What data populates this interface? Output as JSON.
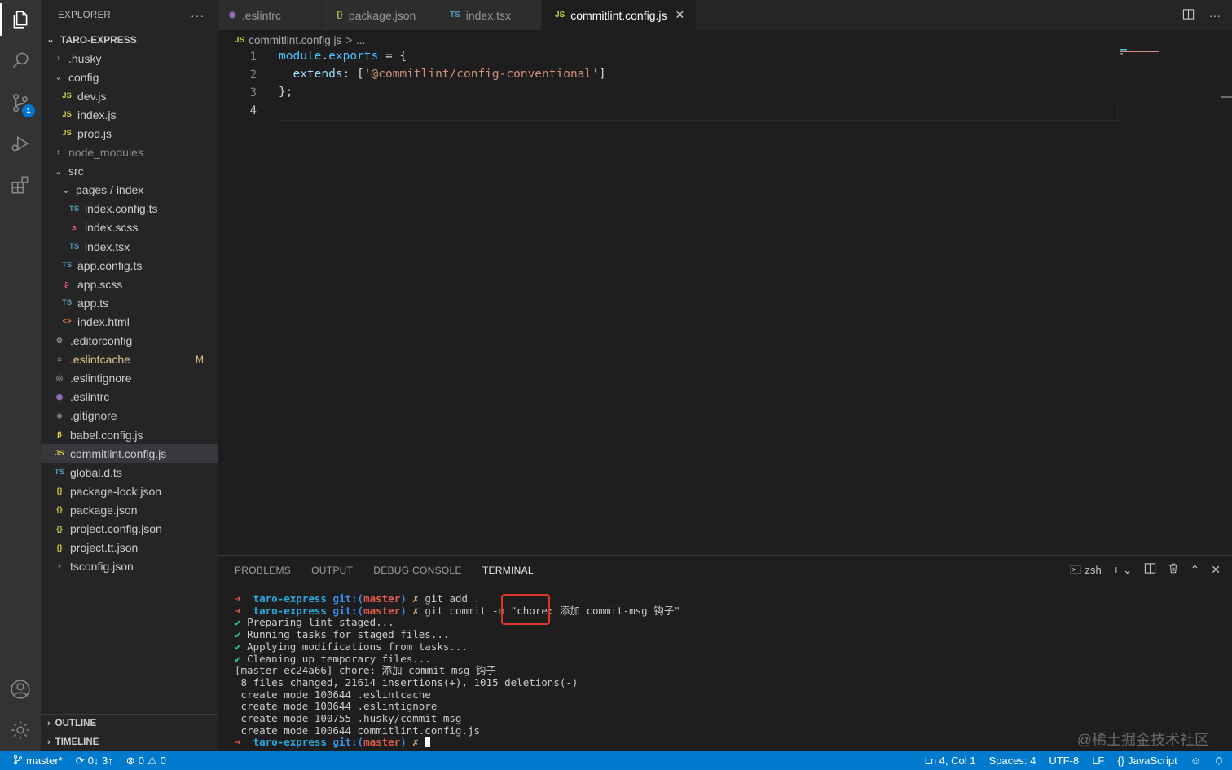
{
  "activity_bar": {
    "scm_badge": "1"
  },
  "sidebar": {
    "title": "EXPLORER",
    "more": "···",
    "project": "TARO-EXPRESS",
    "tree": [
      {
        "label": ".husky",
        "type": "folder",
        "open": false,
        "depth": 1
      },
      {
        "label": "config",
        "type": "folder",
        "open": true,
        "depth": 1
      },
      {
        "label": "dev.js",
        "icon": "JS",
        "depth": 2
      },
      {
        "label": "index.js",
        "icon": "JS",
        "depth": 2
      },
      {
        "label": "prod.js",
        "icon": "JS",
        "depth": 2
      },
      {
        "label": "node_modules",
        "type": "folder",
        "open": false,
        "depth": 1,
        "dim": true
      },
      {
        "label": "src",
        "type": "folder",
        "open": true,
        "depth": 1
      },
      {
        "label": "pages / index",
        "type": "folder",
        "open": true,
        "depth": 2
      },
      {
        "label": "index.config.ts",
        "icon": "TS",
        "depth": 3
      },
      {
        "label": "index.scss",
        "icon": "scss",
        "depth": 3
      },
      {
        "label": "index.tsx",
        "icon": "TS",
        "depth": 3
      },
      {
        "label": "app.config.ts",
        "icon": "TS",
        "depth": 2
      },
      {
        "label": "app.scss",
        "icon": "scss",
        "depth": 2
      },
      {
        "label": "app.ts",
        "icon": "TS",
        "depth": 2
      },
      {
        "label": "index.html",
        "icon": "html",
        "depth": 2
      },
      {
        "label": ".editorconfig",
        "icon": "gear",
        "depth": 1
      },
      {
        "label": ".eslintcache",
        "icon": "lines",
        "depth": 1,
        "modified": "M"
      },
      {
        "label": ".eslintignore",
        "icon": "circle",
        "depth": 1
      },
      {
        "label": ".eslintrc",
        "icon": "eslint",
        "depth": 1
      },
      {
        "label": ".gitignore",
        "icon": "git",
        "depth": 1
      },
      {
        "label": "babel.config.js",
        "icon": "babel",
        "depth": 1
      },
      {
        "label": "commitlint.config.js",
        "icon": "JS",
        "depth": 1,
        "selected": true
      },
      {
        "label": "global.d.ts",
        "icon": "TS",
        "depth": 1
      },
      {
        "label": "package-lock.json",
        "icon": "{}",
        "depth": 1
      },
      {
        "label": "package.json",
        "icon": "{}",
        "depth": 1
      },
      {
        "label": "project.config.json",
        "icon": "{}",
        "depth": 1
      },
      {
        "label": "project.tt.json",
        "icon": "{}",
        "depth": 1
      },
      {
        "label": "tsconfig.json",
        "icon": "tsconfig",
        "depth": 1
      }
    ],
    "outline": "OUTLINE",
    "timeline": "TIMELINE"
  },
  "tabs": [
    {
      "label": ".eslintrc",
      "icon": "◉"
    },
    {
      "label": "package.json",
      "icon": "{}"
    },
    {
      "label": "index.tsx",
      "icon": "TS"
    },
    {
      "label": "commitlint.config.js",
      "icon": "JS",
      "active": true
    }
  ],
  "breadcrumb": {
    "icon": "JS",
    "file": "commitlint.config.js",
    "sep": ">",
    "rest": "..."
  },
  "editor": {
    "line_numbers": [
      "1",
      "2",
      "3",
      "4"
    ],
    "line1": {
      "a": "module",
      "b": ".",
      "c": "exports",
      "d": " = {"
    },
    "line2": {
      "a": "  extends",
      "b": ": [",
      "c": "'@commitlint/config-conventional'",
      "d": "]"
    },
    "line3": "};"
  },
  "panel": {
    "tabs": [
      "PROBLEMS",
      "OUTPUT",
      "DEBUG CONSOLE",
      "TERMINAL"
    ],
    "active_tab": "TERMINAL",
    "shell": "zsh",
    "terminal": {
      "prompt_arrow": "➜",
      "dir": "taro-express",
      "git": "git:(",
      "branch": "master",
      "git_close": ")",
      "dirty": "✗",
      "cmd1": " git add .",
      "cmd2": " git commit -m \"chore: 添加 commit-msg 钩子\"",
      "check": "✔",
      "lines_ok": [
        "Preparing lint-staged...",
        "Running tasks for staged files...",
        "Applying modifications from tasks...",
        "Cleaning up temporary files..."
      ],
      "output": [
        "[master ec24a66] chore: 添加 commit-msg 钩子",
        " 8 files changed, 21614 insertions(+), 1015 deletions(-)",
        " create mode 100644 .eslintcache",
        " create mode 100644 .eslintignore",
        " create mode 100755 .husky/commit-msg",
        " create mode 100644 commitlint.config.js"
      ]
    },
    "watermark": "@稀土掘金技术社区"
  },
  "status_bar": {
    "branch": "master*",
    "sync": "0↓ 3↑",
    "errors": "0",
    "warnings": "0",
    "position": "Ln 4, Col 1",
    "spaces": "Spaces: 4",
    "encoding": "UTF-8",
    "eol": "LF",
    "language": "JavaScript"
  },
  "colors": {
    "accent": "#007acc",
    "highlight_box": "#e0342c"
  }
}
